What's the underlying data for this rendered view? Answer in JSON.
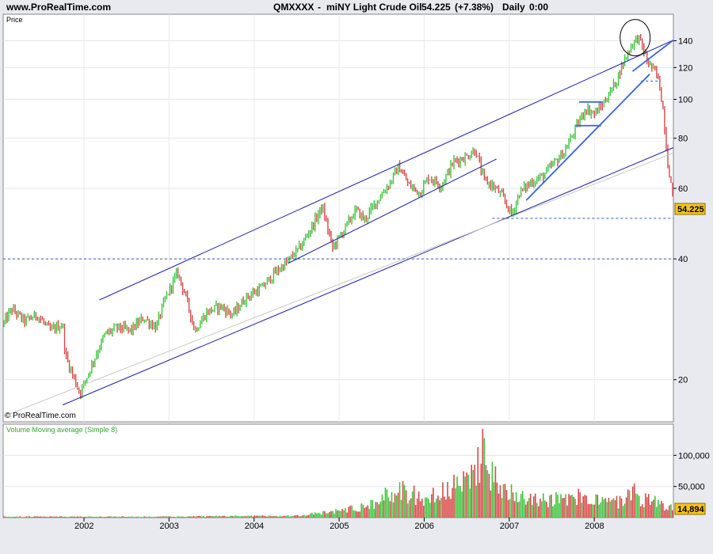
{
  "header": {
    "site": "www.ProRealTime.com",
    "symbol": "QMXXXX",
    "instrument": "miNY Light Crude Oil",
    "last_price": "54.225",
    "change": "(+7.38%)",
    "timeframe": "Daily",
    "time": "0:00"
  },
  "colors": {
    "up": "#3cc63c",
    "down": "#d94848",
    "trend": "#1a1aa8",
    "trend_light": "#3a62e8",
    "panel_bg": "#ffffff",
    "frame_bg": "#e8eaf0",
    "price_tag_bg": "#f5c518",
    "dashed": "#2a5bd8"
  },
  "chart_data": [
    {
      "type": "candlestick",
      "ylabel": "Price",
      "yscale": "log",
      "ylim": [
        15.7,
        163
      ],
      "xlim": [
        2001.05,
        2008.93
      ],
      "grid": true,
      "yticks": [
        20,
        40,
        60,
        80,
        100,
        120,
        140
      ],
      "xticks": [
        "2002",
        "2003",
        "2004",
        "2005",
        "2006",
        "2007",
        "2008"
      ],
      "last_value": 54.225,
      "last_value_label": "54.225",
      "watermark": "© ProRealTime.com",
      "price_path": [
        [
          2001.05,
          27.5
        ],
        [
          2001.15,
          30.0
        ],
        [
          2001.3,
          28.0
        ],
        [
          2001.45,
          29.0
        ],
        [
          2001.6,
          26.5
        ],
        [
          2001.75,
          27.5
        ],
        [
          2001.78,
          23.0
        ],
        [
          2001.85,
          21.0
        ],
        [
          2001.95,
          18.5
        ],
        [
          2002.0,
          19.5
        ],
        [
          2002.1,
          22.0
        ],
        [
          2002.25,
          26.0
        ],
        [
          2002.4,
          27.0
        ],
        [
          2002.55,
          26.5
        ],
        [
          2002.7,
          28.5
        ],
        [
          2002.85,
          27.0
        ],
        [
          2002.95,
          31.5
        ],
        [
          2003.1,
          37.0
        ],
        [
          2003.2,
          32.0
        ],
        [
          2003.3,
          26.5
        ],
        [
          2003.45,
          29.5
        ],
        [
          2003.6,
          30.5
        ],
        [
          2003.75,
          29.0
        ],
        [
          2003.9,
          32.0
        ],
        [
          2004.1,
          34.0
        ],
        [
          2004.25,
          37.0
        ],
        [
          2004.4,
          39.5
        ],
        [
          2004.55,
          43.0
        ],
        [
          2004.7,
          49.0
        ],
        [
          2004.8,
          54.0
        ],
        [
          2004.92,
          42.5
        ],
        [
          2005.05,
          47.0
        ],
        [
          2005.2,
          53.0
        ],
        [
          2005.3,
          50.0
        ],
        [
          2005.45,
          56.0
        ],
        [
          2005.6,
          62.0
        ],
        [
          2005.7,
          68.0
        ],
        [
          2005.82,
          61.0
        ],
        [
          2005.95,
          58.5
        ],
        [
          2006.05,
          64.0
        ],
        [
          2006.2,
          61.0
        ],
        [
          2006.35,
          70.0
        ],
        [
          2006.5,
          72.0
        ],
        [
          2006.6,
          75.0
        ],
        [
          2006.7,
          63.0
        ],
        [
          2006.8,
          61.0
        ],
        [
          2006.9,
          58.0
        ],
        [
          2007.03,
          51.5
        ],
        [
          2007.12,
          58.5
        ],
        [
          2007.25,
          62.0
        ],
        [
          2007.4,
          64.5
        ],
        [
          2007.52,
          69.0
        ],
        [
          2007.65,
          74.0
        ],
        [
          2007.8,
          86.0
        ],
        [
          2007.9,
          95.0
        ],
        [
          2008.0,
          92.0
        ],
        [
          2008.1,
          97.0
        ],
        [
          2008.25,
          110.0
        ],
        [
          2008.35,
          125.0
        ],
        [
          2008.45,
          138.0
        ],
        [
          2008.52,
          143.0
        ],
        [
          2008.62,
          125.0
        ],
        [
          2008.7,
          118.0
        ],
        [
          2008.75,
          113.0
        ],
        [
          2008.8,
          98.0
        ],
        [
          2008.86,
          70.0
        ],
        [
          2008.9,
          62.0
        ],
        [
          2008.93,
          54.225
        ]
      ],
      "trendlines": [
        {
          "from": [
            2002.18,
            31.6
          ],
          "to": [
            2008.93,
            140.5
          ],
          "style": "trend"
        },
        {
          "from": [
            2001.75,
            17.3
          ],
          "to": [
            2008.93,
            75.8
          ],
          "style": "trend"
        },
        {
          "from": [
            2001.05,
            16.2
          ],
          "to": [
            2008.93,
            73.5
          ],
          "style": "gray"
        },
        {
          "from": [
            2004.4,
            39.0
          ],
          "to": [
            2006.85,
            71.0
          ],
          "style": "trend"
        },
        {
          "from": [
            2007.2,
            56.0
          ],
          "to": [
            2008.65,
            115.5
          ],
          "style": "trend_light"
        },
        {
          "from": [
            2008.45,
            117.5
          ],
          "to": [
            2008.93,
            140.5
          ],
          "style": "trend_light"
        },
        {
          "from": [
            2007.82,
            98.5
          ],
          "to": [
            2008.1,
            98.5
          ],
          "style": "trend_light"
        },
        {
          "from": [
            2007.78,
            86.0
          ],
          "to": [
            2008.08,
            86.0
          ],
          "style": "trend_light"
        }
      ],
      "hlines": [
        {
          "y": 40,
          "from": 2001.05,
          "to": 2008.93
        },
        {
          "y": 50.5,
          "from": 2006.8,
          "to": 2008.93
        },
        {
          "y": 111,
          "from": 2008.55,
          "to": 2008.78
        }
      ],
      "annotations": [
        {
          "type": "circle",
          "x": 2008.48,
          "y": 142.5
        }
      ]
    },
    {
      "type": "bar",
      "title": "Volume Moving average (Simple 8)",
      "ylim": [
        0,
        150000
      ],
      "yticks": [
        50000,
        100000
      ],
      "ytick_labels": [
        "50,000",
        "100,000"
      ],
      "last_value": 14894,
      "last_value_label": "14,894",
      "volume_path": [
        [
          2001.05,
          1500
        ],
        [
          2003.0,
          1500
        ],
        [
          2004.5,
          3000
        ],
        [
          2004.9,
          9000
        ],
        [
          2005.3,
          18000
        ],
        [
          2005.5,
          30000
        ],
        [
          2005.7,
          45000
        ],
        [
          2005.9,
          35000
        ],
        [
          2006.0,
          30000
        ],
        [
          2006.3,
          45000
        ],
        [
          2006.5,
          55000
        ],
        [
          2006.6,
          80000
        ],
        [
          2006.7,
          115000
        ],
        [
          2006.8,
          65000
        ],
        [
          2006.9,
          45000
        ],
        [
          2007.1,
          40000
        ],
        [
          2007.4,
          30000
        ],
        [
          2007.7,
          28000
        ],
        [
          2007.9,
          35000
        ],
        [
          2008.1,
          25000
        ],
        [
          2008.3,
          25000
        ],
        [
          2008.4,
          35000
        ],
        [
          2008.45,
          45000
        ],
        [
          2008.55,
          30000
        ],
        [
          2008.75,
          25000
        ],
        [
          2008.93,
          14894
        ]
      ]
    }
  ]
}
